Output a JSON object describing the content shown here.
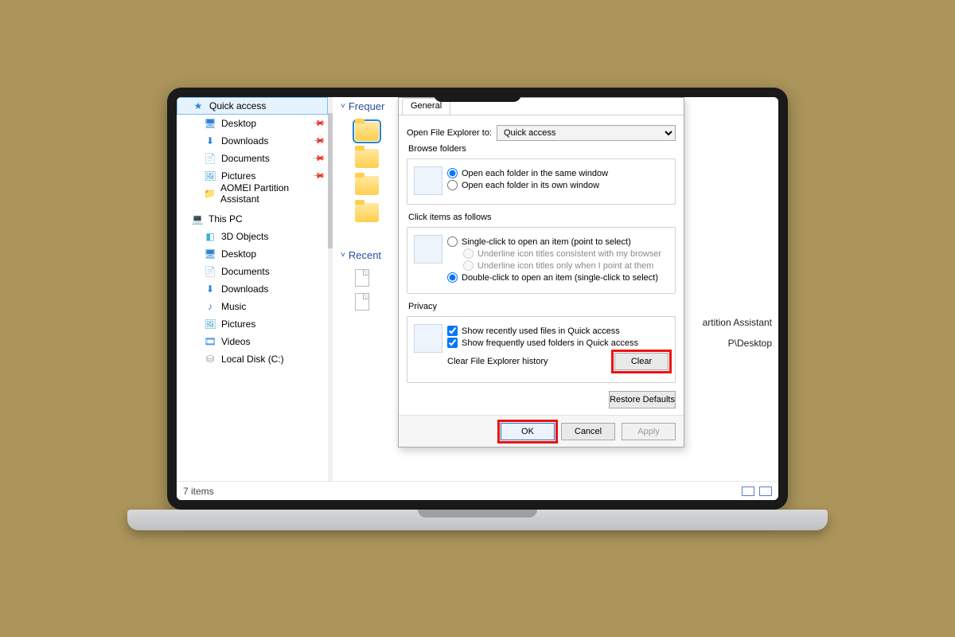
{
  "sidebar": {
    "quick_access": {
      "label": "Quick access"
    },
    "qa_items": [
      {
        "label": "Desktop",
        "icon": "monitor-icon",
        "pinned": true
      },
      {
        "label": "Downloads",
        "icon": "download-icon",
        "pinned": true
      },
      {
        "label": "Documents",
        "icon": "document-icon",
        "pinned": true
      },
      {
        "label": "Pictures",
        "icon": "picture-icon",
        "pinned": true
      },
      {
        "label": "AOMEI Partition Assistant",
        "icon": "folder-icon",
        "pinned": false
      }
    ],
    "this_pc": {
      "label": "This PC"
    },
    "pc_items": [
      {
        "label": "3D Objects",
        "icon": "cube-icon"
      },
      {
        "label": "Desktop",
        "icon": "monitor-icon"
      },
      {
        "label": "Documents",
        "icon": "document-icon"
      },
      {
        "label": "Downloads",
        "icon": "download-icon"
      },
      {
        "label": "Music",
        "icon": "music-icon"
      },
      {
        "label": "Pictures",
        "icon": "picture-icon"
      },
      {
        "label": "Videos",
        "icon": "video-icon"
      },
      {
        "label": "Local Disk (C:)",
        "icon": "disk-icon"
      }
    ]
  },
  "main": {
    "section_frequent": "Frequer",
    "section_recent": "Recent",
    "rside1": "artition Assistant",
    "rside2": "P\\Desktop"
  },
  "status": {
    "text": "7 items"
  },
  "dialog": {
    "tab": "General",
    "open_label": "Open File Explorer to:",
    "open_value": "Quick access",
    "browse": {
      "title": "Browse folders",
      "opt_same": "Open each folder in the same window",
      "opt_own": "Open each folder in its own window"
    },
    "click": {
      "title": "Click items as follows",
      "single": "Single-click to open an item (point to select)",
      "u1": "Underline icon titles consistent with my browser",
      "u2": "Underline icon titles only when I point at them",
      "double": "Double-click to open an item (single-click to select)"
    },
    "privacy": {
      "title": "Privacy",
      "recent_files": "Show recently used files in Quick access",
      "freq_folders": "Show frequently used folders in Quick access",
      "clear_label": "Clear File Explorer history",
      "clear_btn": "Clear"
    },
    "restore": "Restore Defaults",
    "ok": "OK",
    "cancel": "Cancel",
    "apply": "Apply"
  }
}
